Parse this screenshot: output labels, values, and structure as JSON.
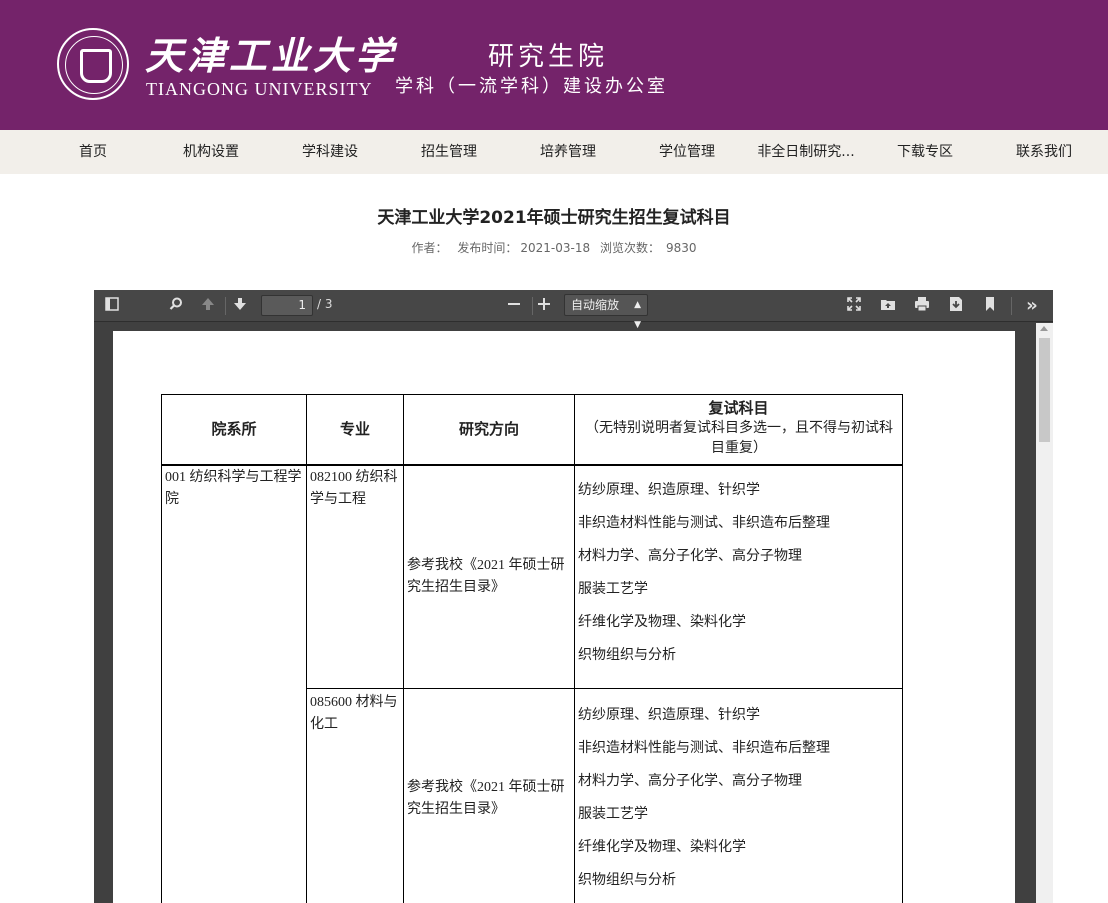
{
  "header": {
    "univ_cn": "天津工业大学",
    "univ_en": "TIANGONG UNIVERSITY",
    "dept_title": "研究生院",
    "dept_subtitle": "学科（一流学科）建设办公室",
    "brand_color": "#74236a"
  },
  "nav": {
    "items": [
      "首页",
      "机构设置",
      "学科建设",
      "招生管理",
      "培养管理",
      "学位管理",
      "非全日制研究...",
      "下载专区",
      "联系我们"
    ]
  },
  "article": {
    "title": "天津工业大学2021年硕士研究生招生复试科目",
    "author_label": "作者：",
    "publish_label": "发布时间：",
    "publish_date": "2021-03-18",
    "views_label": "浏览次数：",
    "views": "9830"
  },
  "viewer": {
    "current_page": "1",
    "total_pages": "/ 3",
    "zoom": "自动缩放",
    "icons": [
      "sidebar-toggle-icon",
      "search-icon",
      "previous-page-icon",
      "next-page-icon",
      "zoom-out-icon",
      "zoom-in-icon",
      "presentation-mode-icon",
      "open-file-icon",
      "print-icon",
      "download-icon",
      "bookmark-icon",
      "tools-icon"
    ]
  },
  "pdf_table": {
    "headers": {
      "col1": "院系所",
      "col2": "专业",
      "col3": "研究方向",
      "col4_title": "复试科目",
      "col4_note": "（无特别说明者复试科目多选一，且不得与初试科目重复）"
    },
    "dept": "001 纺织科学与工程学院",
    "rows": [
      {
        "major": "082100 纺织科学与工程",
        "direction": "参考我校《2021 年硕士研究生招生目录》",
        "subjects": [
          "纺纱原理、织造原理、针织学",
          "非织造材料性能与测试、非织造布后整理",
          "材料力学、高分子化学、高分子物理",
          "服装工艺学",
          "纤维化学及物理、染料化学",
          "织物组织与分析"
        ]
      },
      {
        "major": "085600 材料与化工",
        "direction": "参考我校《2021 年硕士研究生招生目录》",
        "subjects": [
          "纺纱原理、织造原理、针织学",
          "非织造材料性能与测试、非织造布后整理",
          "材料力学、高分子化学、高分子物理",
          "服装工艺学",
          "纤维化学及物理、染料化学",
          "织物组织与分析"
        ]
      }
    ]
  }
}
